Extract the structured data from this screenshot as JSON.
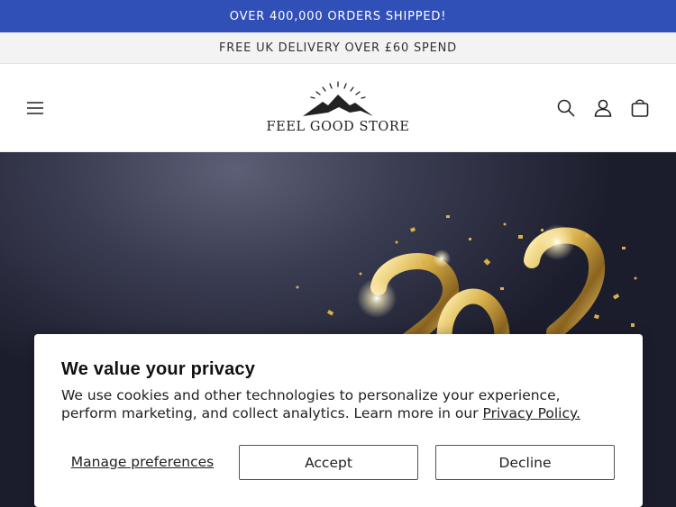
{
  "announcement": {
    "primary": "OVER 400,000 ORDERS SHIPPED!",
    "secondary": "FREE UK DELIVERY OVER £60 SPEND"
  },
  "header": {
    "logo_text": "FEEL GOOD STORE",
    "icons": [
      "menu-icon",
      "search-icon",
      "account-icon",
      "cart-icon"
    ]
  },
  "colors": {
    "announcement_bg": "#3050b8",
    "hero_bg": "#2a2c40",
    "gold": "#d9b04a"
  },
  "cookie_banner": {
    "title": "We value your privacy",
    "body": "We use cookies and other technologies to personalize your experience, perform marketing, and collect analytics. Learn more in our ",
    "link": "Privacy Policy.",
    "manage_label": "Manage preferences",
    "accept_label": "Accept",
    "decline_label": "Decline"
  }
}
